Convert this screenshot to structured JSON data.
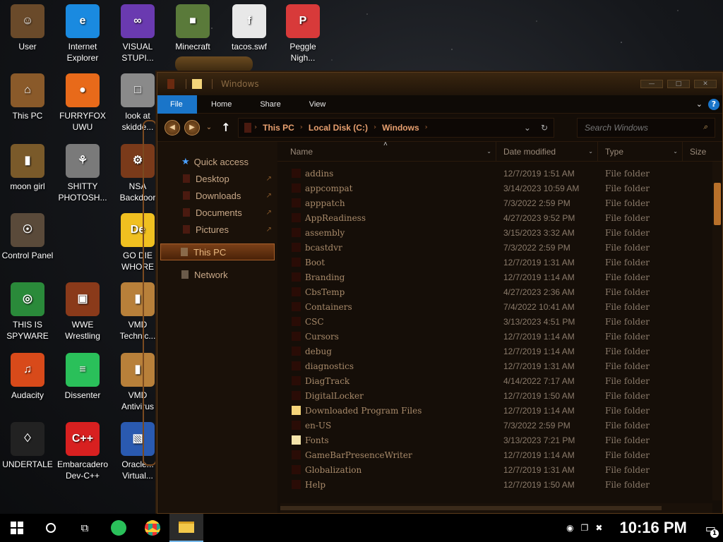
{
  "desktop_icons": [
    {
      "label": "User",
      "glyph": "☺",
      "color": "#6a4a2a"
    },
    {
      "label": "Internet\nExplorer",
      "glyph": "e",
      "color": "#1a8ae0"
    },
    {
      "label": "VISUAL\nSTUPI...",
      "glyph": "∞",
      "color": "#6a3ab0"
    },
    {
      "label": "Minecraft",
      "glyph": "■",
      "color": "#5a7a3a"
    },
    {
      "label": "tacos.swf",
      "glyph": "f",
      "color": "#e8e8e8"
    },
    {
      "label": "Peggle\nNigh...",
      "glyph": "P",
      "color": "#d83a3a"
    },
    {
      "label": "This PC",
      "glyph": "⌂",
      "color": "#8a5a2a"
    },
    {
      "label": "FURRYFOX\nUWU",
      "glyph": "●",
      "color": "#e86a1a"
    },
    {
      "label": "look at\nskidde...",
      "glyph": "□",
      "color": "#8a8a8a"
    },
    {
      "label": "moon girl",
      "glyph": "▮",
      "color": "#7a5a2a"
    },
    {
      "label": "SHITTY\nPHOTOSH...",
      "glyph": "⚘",
      "color": "#7a7a7a"
    },
    {
      "label": "NSA\nBackdoor",
      "glyph": "⚙",
      "color": "#7a3a1a"
    },
    {
      "label": "Control Panel",
      "glyph": "☉",
      "color": "#5a4a3a"
    },
    {
      "label": "GO DIE\nWHORE",
      "glyph": "De",
      "color": "#f0c020"
    },
    {
      "label": "THIS IS\nSPYWARE",
      "glyph": "◎",
      "color": "#2a8a3a"
    },
    {
      "label": "WWE\nWrestling",
      "glyph": "▣",
      "color": "#8a3a1a"
    },
    {
      "label": "VMD\nTechnic...",
      "glyph": "▮",
      "color": "#b8803a"
    },
    {
      "label": "Audacity",
      "glyph": "♫",
      "color": "#d84a1a"
    },
    {
      "label": "Dissenter",
      "glyph": "≡",
      "color": "#2ac05a"
    },
    {
      "label": "VMD\nAntivirus",
      "glyph": "▮",
      "color": "#b8803a"
    },
    {
      "label": "UNDERTALE",
      "glyph": "♢",
      "color": "#222"
    },
    {
      "label": "Embarcadero\nDev-C++",
      "glyph": "C++",
      "color": "#d82020"
    },
    {
      "label": "Oracle...\nVirtual...",
      "glyph": "▧",
      "color": "#2a5ab0"
    }
  ],
  "window": {
    "title": "Windows",
    "controls": [
      "—",
      "□",
      "✕"
    ]
  },
  "ribbon": {
    "tabs": [
      "File",
      "Home",
      "Share",
      "View"
    ],
    "expand": "⌄",
    "help": "?"
  },
  "address": {
    "back": "◀",
    "forward": "▶",
    "recent": "⌄",
    "up": "↑",
    "crumbs": [
      "This PC",
      "Local Disk (C:)",
      "Windows"
    ],
    "crumb_sep": "›",
    "dropdown": "⌄",
    "refresh": "↻",
    "search_placeholder": "Search Windows",
    "search_icon": "⌕"
  },
  "navpane": {
    "quick_access": "Quick access",
    "quick_items": [
      "Desktop",
      "Downloads",
      "Documents",
      "Pictures"
    ],
    "this_pc": "This PC",
    "network": "Network",
    "pin": "↗"
  },
  "columns": {
    "name": "Name",
    "date": "Date modified",
    "type": "Type",
    "size": "Size",
    "sort_up": "˄",
    "caret": "⌄"
  },
  "files": [
    {
      "name": "addins",
      "date": "12/7/2019 1:51 AM",
      "type": "File folder",
      "icon": "folder-dark"
    },
    {
      "name": "appcompat",
      "date": "3/14/2023 10:59 AM",
      "type": "File folder",
      "icon": "folder-dark"
    },
    {
      "name": "apppatch",
      "date": "7/3/2022 2:59 PM",
      "type": "File folder",
      "icon": "folder-dark"
    },
    {
      "name": "AppReadiness",
      "date": "4/27/2023 9:52 PM",
      "type": "File folder",
      "icon": "folder-dark"
    },
    {
      "name": "assembly",
      "date": "3/15/2023 3:32 AM",
      "type": "File folder",
      "icon": "folder-dark"
    },
    {
      "name": "bcastdvr",
      "date": "7/3/2022 2:59 PM",
      "type": "File folder",
      "icon": "folder-dark"
    },
    {
      "name": "Boot",
      "date": "12/7/2019 1:31 AM",
      "type": "File folder",
      "icon": "folder-dark"
    },
    {
      "name": "Branding",
      "date": "12/7/2019 1:14 AM",
      "type": "File folder",
      "icon": "folder-dark"
    },
    {
      "name": "CbsTemp",
      "date": "4/27/2023 2:36 AM",
      "type": "File folder",
      "icon": "folder-dark"
    },
    {
      "name": "Containers",
      "date": "7/4/2022 10:41 AM",
      "type": "File folder",
      "icon": "folder-dark"
    },
    {
      "name": "CSC",
      "date": "3/13/2023 4:51 PM",
      "type": "File folder",
      "icon": "folder-dark"
    },
    {
      "name": "Cursors",
      "date": "12/7/2019 1:14 AM",
      "type": "File folder",
      "icon": "folder-dark"
    },
    {
      "name": "debug",
      "date": "12/7/2019 1:14 AM",
      "type": "File folder",
      "icon": "folder-dark"
    },
    {
      "name": "diagnostics",
      "date": "12/7/2019 1:31 AM",
      "type": "File folder",
      "icon": "folder-dark"
    },
    {
      "name": "DiagTrack",
      "date": "4/14/2022 7:17 AM",
      "type": "File folder",
      "icon": "folder-dark"
    },
    {
      "name": "DigitalLocker",
      "date": "12/7/2019 1:50 AM",
      "type": "File folder",
      "icon": "folder-dark"
    },
    {
      "name": "Downloaded Program Files",
      "date": "12/7/2019 1:14 AM",
      "type": "File folder",
      "icon": "folder-yellow"
    },
    {
      "name": "en-US",
      "date": "7/3/2022 2:59 PM",
      "type": "File folder",
      "icon": "folder-dark"
    },
    {
      "name": "Fonts",
      "date": "3/13/2023 7:21 PM",
      "type": "File folder",
      "icon": "folder-fonts"
    },
    {
      "name": "GameBarPresenceWriter",
      "date": "12/7/2019 1:14 AM",
      "type": "File folder",
      "icon": "folder-dark"
    },
    {
      "name": "Globalization",
      "date": "12/7/2019 1:31 AM",
      "type": "File folder",
      "icon": "folder-dark"
    },
    {
      "name": "Help",
      "date": "12/7/2019 1:50 AM",
      "type": "File folder",
      "icon": "folder-dark"
    }
  ],
  "taskbar": {
    "clock": "10:16 PM",
    "notification_count": "1",
    "tray_icons": [
      "◉",
      "❐",
      "✖"
    ],
    "notif_glyph": "▭"
  }
}
